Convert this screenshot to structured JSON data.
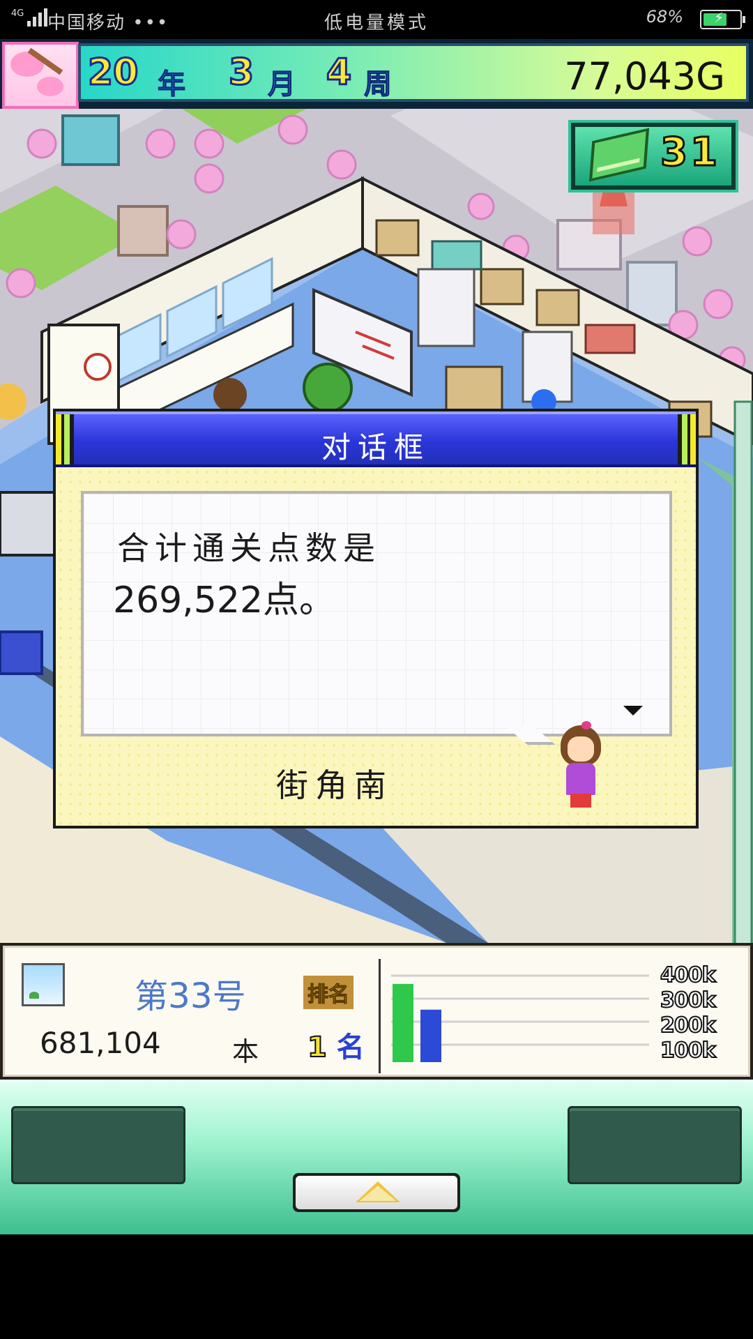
{
  "status_bar": {
    "network": "4G",
    "carrier": "中国移动 •••",
    "mode": "低电量模式",
    "battery_percent": "68%",
    "battery_level": 0.68
  },
  "header": {
    "year": "20",
    "year_unit": "年",
    "month": "3",
    "month_unit": "月",
    "week": "4",
    "week_unit": "周",
    "money": "77,043G",
    "season_icon": "cherry-blossom-icon"
  },
  "book_counter": {
    "icon": "book-icon",
    "count": "31"
  },
  "dialog": {
    "title": "对话框",
    "line1": "合计通关点数是",
    "line2": "269,522点。",
    "speaker": "街角南"
  },
  "info_panel": {
    "issue_prefix": "第",
    "issue_number": "33",
    "issue_suffix": "号",
    "rank_label": "排名",
    "sales": "681,104",
    "sales_unit": "本",
    "rank_number": "1",
    "rank_unit": "名",
    "axis_labels": [
      "400k",
      "300k",
      "200k",
      "100k"
    ]
  },
  "chart_data": {
    "type": "bar",
    "categories": [
      "",
      ""
    ],
    "values": [
      340000,
      228000
    ],
    "colors": [
      "#2ec84a",
      "#2b4ad6"
    ],
    "ylim": [
      0,
      400000
    ],
    "grid": true
  },
  "controls": {
    "left_button": "",
    "right_button": "",
    "up_button_icon": "triangle-up-icon"
  },
  "colors": {
    "dialog_title_bg": "#2b35d8",
    "money_bar_start": "#27d7c9",
    "money_bar_end": "#e9ff61",
    "controls_bg": "#3bbf8e"
  }
}
